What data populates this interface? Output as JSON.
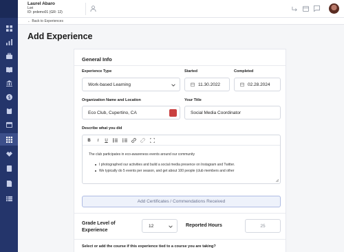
{
  "header": {
    "student_name": "Laurel Abaro",
    "student_first": "Lori",
    "student_id": "ID: prdemo01 (GR: 12)"
  },
  "nav": {
    "back_label": "← Back to Experiences",
    "rail_icons": [
      "grid-icon",
      "chart-icon",
      "briefcase-icon",
      "book-icon",
      "bank-icon",
      "dollar-icon",
      "clipboard-icon",
      "calendar-icon",
      "apps-icon",
      "handshake-icon",
      "notebook-icon",
      "document-icon",
      "list-icon"
    ],
    "active_index": 8
  },
  "page": {
    "title": "Add Experience"
  },
  "form": {
    "section_title": "General Info",
    "experience_type": {
      "label": "Experience Type",
      "value": "Work-based Learning"
    },
    "started": {
      "label": "Started",
      "value": "11.30.2022"
    },
    "completed": {
      "label": "Completed",
      "value": "02.28.2024"
    },
    "organization": {
      "label": "Organization Name and Location",
      "value": "Eco Club, Cupertino, CA"
    },
    "your_title": {
      "label": "Your Title",
      "value": "Social Media Coordinator"
    },
    "describe": {
      "label": "Describe what you did",
      "paragraph": "The club participates in eco-awareness events around our community",
      "bullets": [
        "I photographed our activities and build a social media presence on Instagram and Twitter.",
        "We typically do 5 events per season, and get about 100 people (club members and other"
      ]
    },
    "certificates_button": "Add Certificates / Commendations Received",
    "grade_level": {
      "label": "Grade Level of Experience",
      "value": "12"
    },
    "reported_hours": {
      "label": "Reported Hours",
      "placeholder": "25"
    },
    "course_question": "Select or add the course if this experience tied to a course you are taking?"
  },
  "colors": {
    "rail": "#24356b",
    "accent": "#aebbe3",
    "danger": "#c94040"
  }
}
